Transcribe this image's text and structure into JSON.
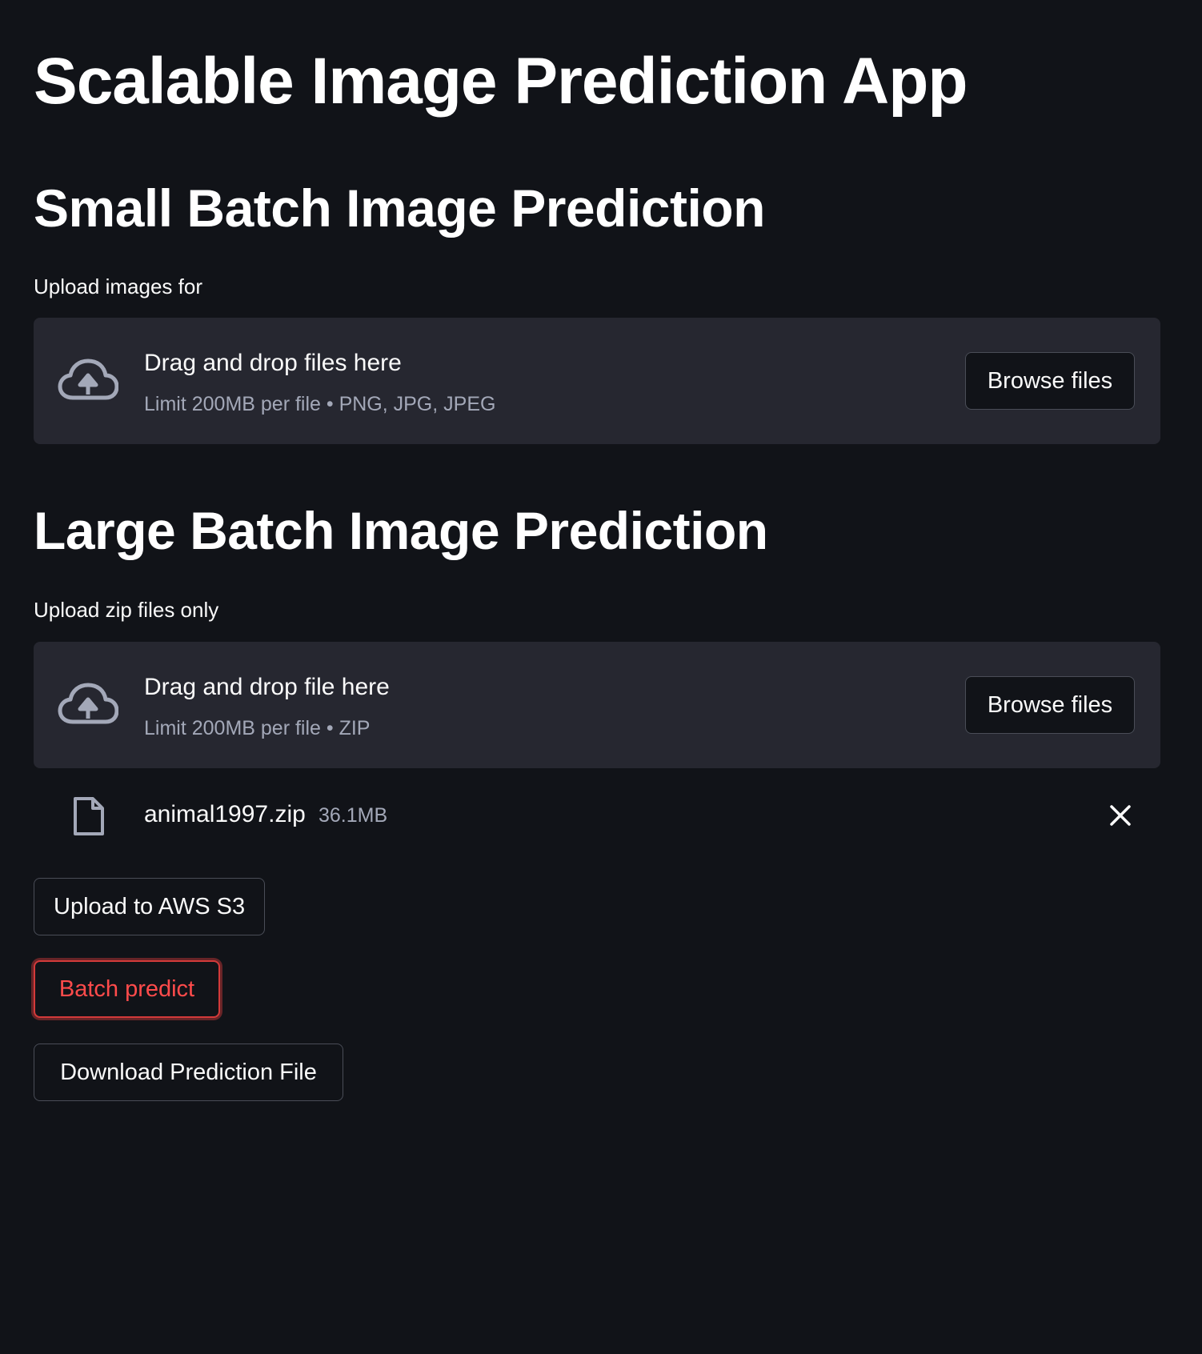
{
  "app": {
    "title": "Scalable Image Prediction App"
  },
  "small_batch": {
    "heading": "Small Batch Image Prediction",
    "label": "Upload images for",
    "dropzone": {
      "icon": "cloud-upload-icon",
      "title": "Drag and drop files here",
      "limit": "Limit 200MB per file • PNG, JPG, JPEG",
      "browse_label": "Browse files"
    }
  },
  "large_batch": {
    "heading": "Large Batch Image Prediction",
    "label": "Upload zip files only",
    "dropzone": {
      "icon": "cloud-upload-icon",
      "title": "Drag and drop file here",
      "limit": "Limit 200MB per file • ZIP",
      "browse_label": "Browse files"
    },
    "uploaded_file": {
      "icon": "file-icon",
      "name": "animal1997.zip",
      "size": "36.1MB",
      "remove_icon": "close-icon"
    }
  },
  "actions": {
    "upload_s3_label": "Upload to AWS S3",
    "batch_predict_label": "Batch predict",
    "download_label": "Download Prediction File"
  },
  "colors": {
    "background": "#111318",
    "panel": "#262730",
    "text": "#fafafa",
    "muted_text": "#a3a8b8",
    "focus_accent": "#ff4b4b"
  }
}
